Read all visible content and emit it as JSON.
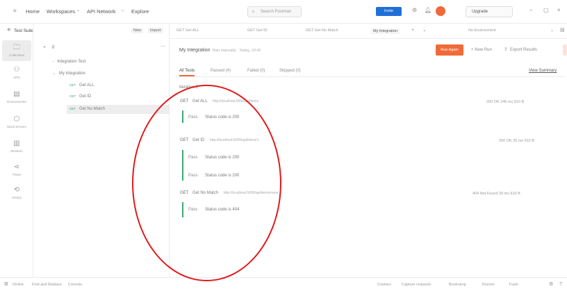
{
  "topbar": {
    "menu_icon": "menu-icon",
    "nav": [
      "Home",
      "Workspaces",
      "API Network",
      "Explore"
    ],
    "search_placeholder": "Search Postman",
    "invite_label": "Invite",
    "upgrade_label": "Upgrade"
  },
  "workspace": {
    "name": "Test Suite",
    "new_label": "New",
    "import_label": "Import"
  },
  "sidebar": {
    "items": [
      {
        "label": "Collections",
        "icon": "collections-icon"
      },
      {
        "label": "APIs",
        "icon": "apis-icon"
      },
      {
        "label": "Environments",
        "icon": "environments-icon"
      },
      {
        "label": "Mock Servers",
        "icon": "mock-servers-icon"
      },
      {
        "label": "Monitors",
        "icon": "monitors-icon"
      },
      {
        "label": "Flows",
        "icon": "flows-icon"
      },
      {
        "label": "History",
        "icon": "history-icon"
      }
    ]
  },
  "tree": {
    "items": [
      {
        "label": "Integration Test",
        "method": ""
      },
      {
        "label": "My Integration",
        "method": ""
      },
      {
        "label": "Get ALL",
        "method": "GET"
      },
      {
        "label": "Get ID",
        "method": "GET"
      },
      {
        "label": "Get No Match",
        "method": "GET"
      }
    ]
  },
  "tabs": [
    "GET Get ALL",
    "GET Get ID",
    "GET Get No Match",
    "My Integration"
  ],
  "env_label": "No Environment",
  "runner": {
    "title": "My Integration",
    "subtitle": "Ran manually · Today, 10:42",
    "run_again": "Run Again",
    "new_run": "+ New Run",
    "export": "Export Results",
    "view_summary": "View Summary",
    "filters": [
      "All Tests",
      "Passed (4)",
      "Failed (0)",
      "Skipped (0)"
    ],
    "iteration": "Iteration 1",
    "requests": [
      {
        "method": "GET",
        "name": "Get ALL",
        "url": "http://localhost:5000/api/items",
        "meta": "200 OK   246 ms   910 B",
        "tests": [
          {
            "status": "Pass",
            "text": "Status code is 200"
          }
        ]
      },
      {
        "method": "GET",
        "name": "Get ID",
        "url": "http://localhost:5000/api/items/1",
        "meta": "200 OK   35 ms   910 B",
        "tests": [
          {
            "status": "Pass",
            "text": "Status code is 200"
          },
          {
            "status": "Pass",
            "text": "Status code is 200"
          }
        ]
      },
      {
        "method": "GET",
        "name": "Get No Match",
        "url": "http://localhost:5000/api/items/none",
        "meta": "404 Not Found   30 ms   910 B",
        "tests": [
          {
            "status": "Pass",
            "text": "Status code is 404"
          }
        ]
      }
    ]
  },
  "statusbar": {
    "left": [
      "Online",
      "Find and Replace",
      "Console"
    ],
    "right": [
      "Cookies",
      "Capture requests",
      "Bootcamp",
      "Runner",
      "Trash"
    ]
  },
  "colors": {
    "accent": "#ef6a38",
    "pass": "#3aa86f",
    "invite": "#1f6fd6",
    "annotation": "#e0191a"
  }
}
